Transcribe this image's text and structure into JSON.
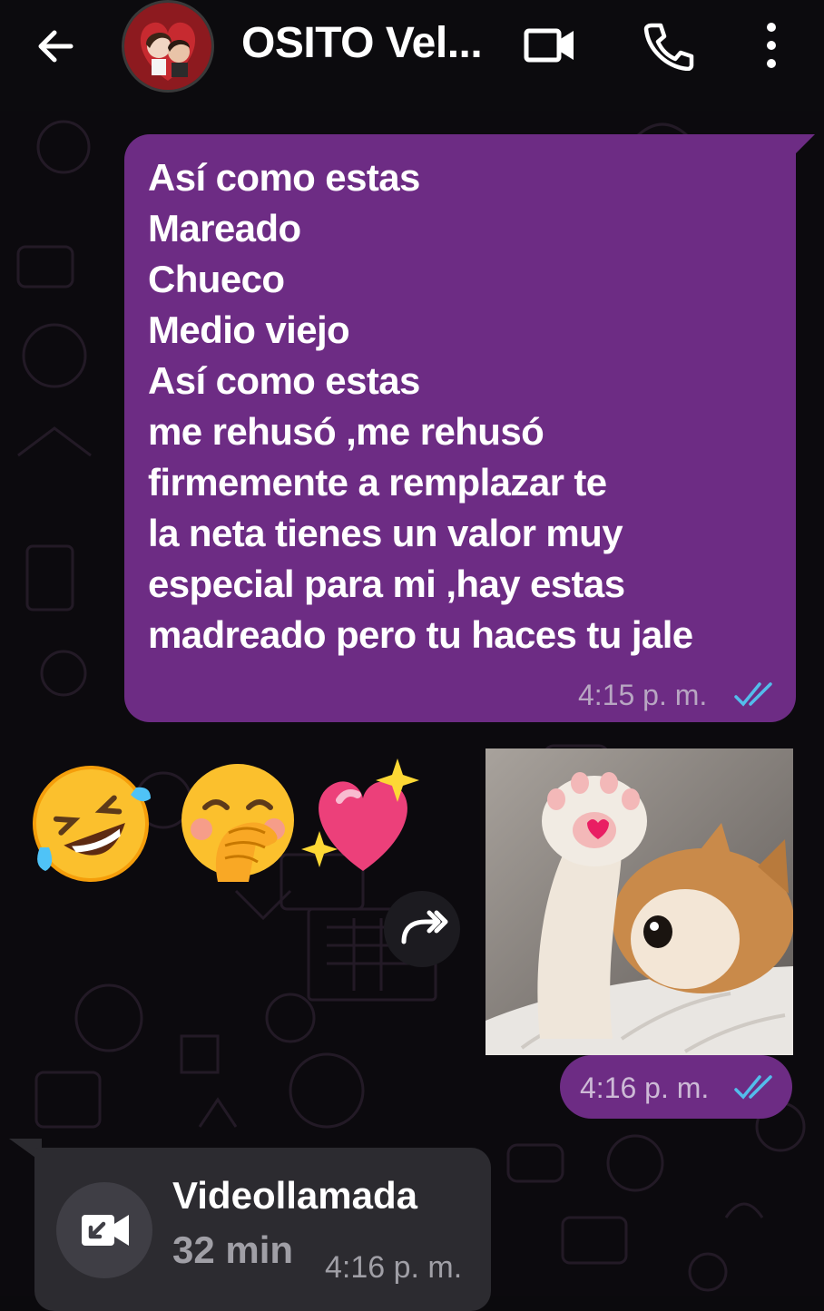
{
  "header": {
    "contact_name": "OSITO Vel...",
    "back_icon": "arrow-left-icon",
    "video_icon": "video-camera-icon",
    "call_icon": "phone-icon",
    "menu_icon": "more-vertical-icon"
  },
  "messages": {
    "outgoing_text": {
      "lines": [
        "Así como estas",
        "Mareado",
        "Chueco",
        "Medio viejo",
        "Así como estas",
        "me rehusó ,me rehusó",
        "firmemente a remplazar te",
        "la neta tienes un valor muy",
        "especial para mi ,hay estas",
        "madreado pero tu haces tu jale"
      ],
      "time": "4:15 p. m.",
      "status_icon": "double-check-read-icon"
    },
    "incoming_emojis": [
      "rolling-on-floor-laughing-emoji",
      "hand-over-mouth-emoji",
      "sparkling-heart-emoji"
    ],
    "outgoing_sticker": {
      "description_icon": "kitten-sticker",
      "time": "4:16 p. m.",
      "status_icon": "double-check-read-icon"
    },
    "video_call": {
      "title": "Videollamada",
      "duration": "32 min",
      "time": "4:16 p. m.",
      "icon": "missed-video-call-icon"
    }
  },
  "colors": {
    "outgoing_bubble": "#6d2c84",
    "incoming_bubble": "#2c2b30",
    "read_ticks": "#53bdeb",
    "background": "#0c0a0e"
  }
}
